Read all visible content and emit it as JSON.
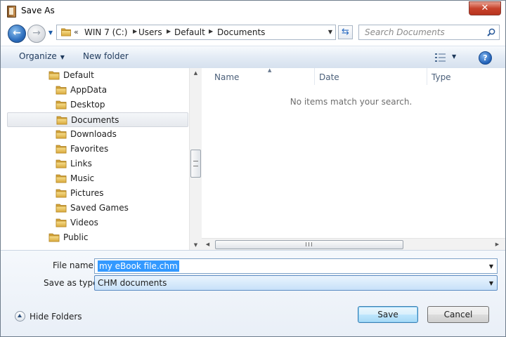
{
  "window": {
    "title": "Save As",
    "close_glyph": "✕"
  },
  "address": {
    "overflow": "«",
    "crumbs": [
      "WIN 7 (C:)",
      "Users",
      "Default",
      "Documents"
    ]
  },
  "search": {
    "placeholder": "Search Documents"
  },
  "toolbar": {
    "organize_label": "Organize",
    "new_folder_label": "New folder",
    "help_label": "?"
  },
  "nav_tree": {
    "items": [
      {
        "label": "Default",
        "level": 1
      },
      {
        "label": "AppData",
        "level": 2
      },
      {
        "label": "Desktop",
        "level": 2
      },
      {
        "label": "Documents",
        "level": 2,
        "selected": true
      },
      {
        "label": "Downloads",
        "level": 2
      },
      {
        "label": "Favorites",
        "level": 2
      },
      {
        "label": "Links",
        "level": 2
      },
      {
        "label": "Music",
        "level": 2
      },
      {
        "label": "Pictures",
        "level": 2
      },
      {
        "label": "Saved Games",
        "level": 2
      },
      {
        "label": "Videos",
        "level": 2
      },
      {
        "label": "Public",
        "level": 1
      }
    ]
  },
  "file_list": {
    "columns": [
      "Name",
      "Date",
      "Type"
    ],
    "empty_message": "No items match your search."
  },
  "form": {
    "file_name_label": "File name:",
    "file_name_value": "my eBook file.chm",
    "save_type_label": "Save as type:",
    "save_type_value": "CHM documents"
  },
  "footer": {
    "hide_folders_label": "Hide Folders",
    "save_label": "Save",
    "cancel_label": "Cancel"
  },
  "colors": {
    "accent": "#3399ff",
    "toolbar_text": "#1e395b",
    "folder": "#e8c25a"
  }
}
